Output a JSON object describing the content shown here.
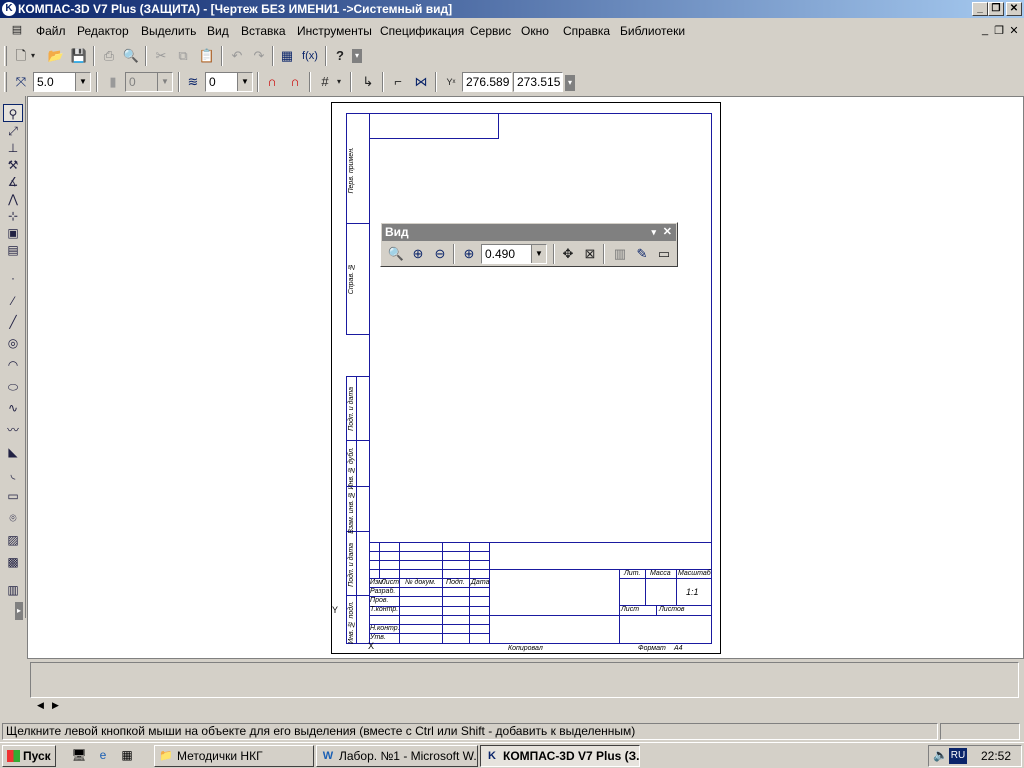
{
  "window": {
    "title": "КОМПАС-3D V7 Plus (ЗАЩИТА) - [Чертеж БЕЗ ИМЕНИ1 ->Системный вид]",
    "icon": "kompas-logo-icon",
    "min": "_",
    "restore": "❐",
    "close": "✕"
  },
  "mdi": {
    "min": "_",
    "restore": "❐",
    "close": "✕"
  },
  "menu": [
    "Файл",
    "Редактор",
    "Выделить",
    "Вид",
    "Вставка",
    "Инструменты",
    "Спецификация",
    "Сервис",
    "Окно",
    "Справка",
    "Библиотеки"
  ],
  "toolbar_props": {
    "step": "5.0",
    "layer_num": "0",
    "layer": "0",
    "x": "276.589",
    "y": "273.515"
  },
  "vid_panel": {
    "title": "Вид",
    "scale": "0.490"
  },
  "stamp": {
    "left_labels": [
      "Перв. примен.",
      "Справ. №",
      "Подп. и дата",
      "Инв. № дубл.",
      "Взам. инв. №",
      "Подп. и дата",
      "Инв. № подл."
    ],
    "header": [
      "Изм.",
      "Лист",
      "№ докум.",
      "Подп.",
      "Дата"
    ],
    "rows": [
      "Разраб.",
      "Пров.",
      "Т.контр.",
      "Н.контр.",
      "Утв."
    ],
    "right_header": [
      "Лит.",
      "Масса",
      "Масштаб"
    ],
    "scale_val": "1:1",
    "sheet_labels": [
      "Лист",
      "Листов"
    ],
    "copied": "Копировал",
    "format": "Формат",
    "format_val": "A4",
    "axis_y": "Y",
    "axis_x": "X"
  },
  "status": {
    "hint": "Щелкните левой кнопкой мыши на объекте для его выделения (вместе с Ctrl или Shift - добавить к выделенным)"
  },
  "taskbar": {
    "start": "Пуск",
    "items": [
      {
        "label": "Методички НКГ",
        "icon": "folder-icon"
      },
      {
        "label": "Лабор. №1 - Microsoft W...",
        "icon": "word-icon"
      },
      {
        "label": "КОМПАС-3D V7 Plus (З...",
        "icon": "kompas-icon"
      }
    ],
    "lang": "RU",
    "time": "22:52"
  }
}
